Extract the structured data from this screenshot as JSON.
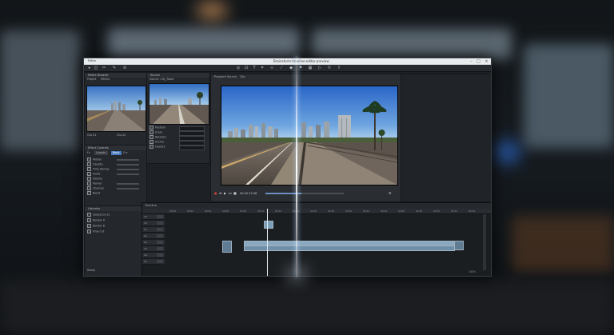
{
  "window": {
    "title": "Brainstorm·timeline·editor·preview",
    "app_label": "Editor"
  },
  "toolbar": {
    "icons": [
      "select-icon",
      "trim-icon",
      "cut-icon",
      "hand-icon",
      "zoom-icon",
      "ripple-icon",
      "slip-icon",
      "text-icon",
      "crop-icon",
      "link-icon",
      "snap-icon",
      "marker-icon",
      "flag-icon"
    ],
    "menu_items": [
      "File",
      "Edit",
      "Clip",
      "View"
    ]
  },
  "project_panel": {
    "header": "Media Browser",
    "tabs": [
      "Project",
      "Effects"
    ],
    "items": [
      "Clip 01",
      "Clip 02",
      "Clip 03",
      "Clip 04"
    ]
  },
  "source_panel": {
    "header": "Source",
    "subheader": "Source: City_Road",
    "props": [
      "Position",
      "Scale",
      "Rotation",
      "Anchor",
      "Opacity"
    ]
  },
  "effects_panel": {
    "header": "Effect Controls",
    "rows": [
      "Motion",
      "Opacity",
      "Time Remap",
      "Audio",
      "Volume",
      "Panner",
      "Channel",
      "Blend"
    ]
  },
  "effects_panel_tabs": [
    "Fx",
    "Lumetri",
    "Basic",
    "Crv"
  ],
  "viewer": {
    "tabs": [
      "Program",
      "Source",
      "Clip"
    ],
    "timecode": "00:00:12:08",
    "zoom": "Fit"
  },
  "browser_panel": {
    "header": "Libraries",
    "items": [
      "Sequence 01",
      "Render A",
      "Render B",
      "Final Cut"
    ]
  },
  "timeline": {
    "header": "Timeline",
    "ticks": [
      "00:00",
      "00:02",
      "00:04",
      "00:06",
      "00:08",
      "00:10",
      "00:12",
      "00:14",
      "00:16",
      "00:18",
      "00:20",
      "00:22",
      "00:24",
      "00:26",
      "00:28",
      "00:30",
      "00:32",
      "00:34"
    ],
    "tracks": [
      "V3",
      "V2",
      "V1",
      "A1",
      "A2",
      "A3",
      "A4",
      "A5"
    ]
  },
  "status": {
    "left": "Ready",
    "right": "100%"
  }
}
